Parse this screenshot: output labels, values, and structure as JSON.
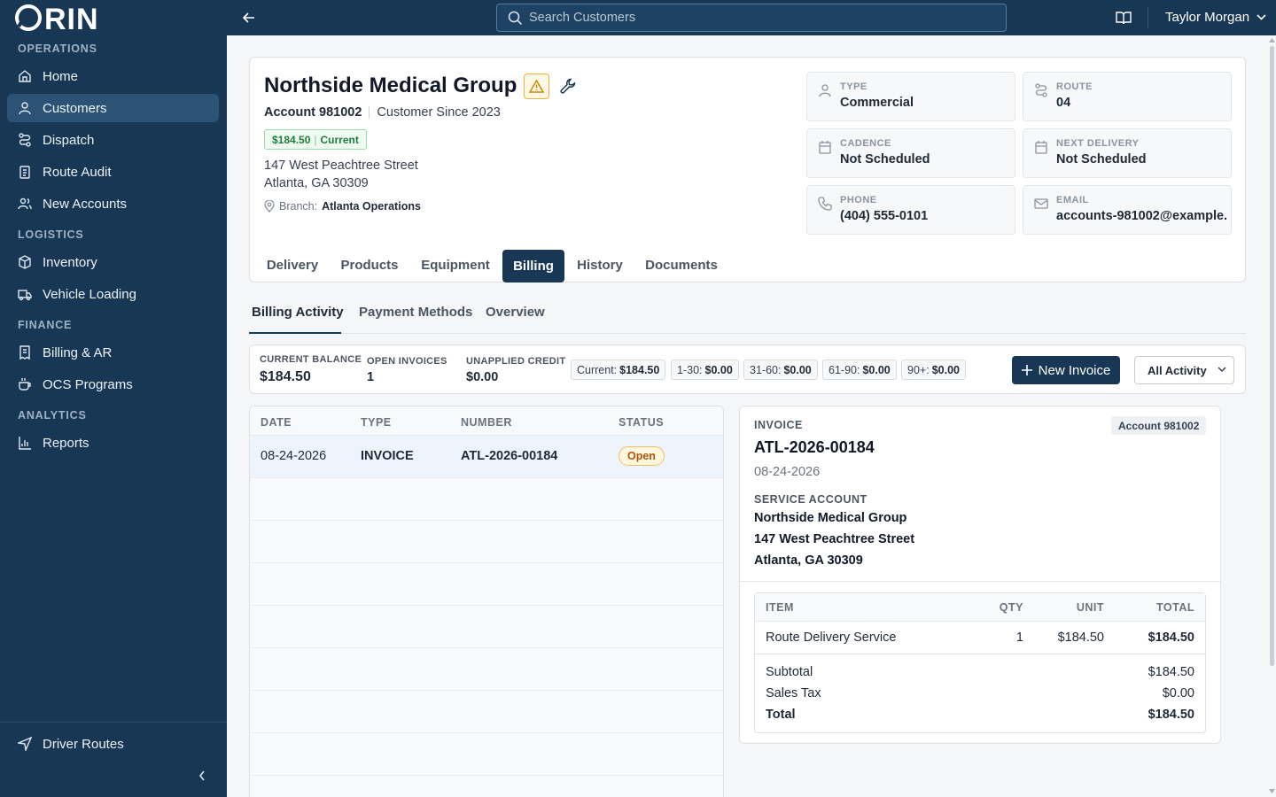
{
  "brand": {
    "logo_text": "ORIN"
  },
  "sidebar": {
    "sections": [
      {
        "title": "OPERATIONS"
      },
      {
        "title": "LOGISTICS"
      },
      {
        "title": "FINANCE"
      },
      {
        "title": "ANALYTICS"
      }
    ],
    "items": [
      {
        "label": "Home",
        "icon": "home-icon"
      },
      {
        "label": "Customers",
        "icon": "user-icon",
        "active": true
      },
      {
        "label": "Dispatch",
        "icon": "route-icon"
      },
      {
        "label": "Route Audit",
        "icon": "clipboard-icon"
      },
      {
        "label": "New Accounts",
        "icon": "users-icon"
      },
      {
        "label": "Inventory",
        "icon": "box-icon"
      },
      {
        "label": "Vehicle Loading",
        "icon": "truck-icon"
      },
      {
        "label": "Billing & AR",
        "icon": "receipt-icon"
      },
      {
        "label": "OCS Programs",
        "icon": "coffee-icon"
      },
      {
        "label": "Reports",
        "icon": "bar-chart-icon"
      }
    ],
    "footer_item": {
      "label": "Driver Routes",
      "icon": "navigation-icon"
    }
  },
  "topbar": {
    "search_placeholder": "Search Customers",
    "user_name": "Taylor Morgan"
  },
  "customer": {
    "name": "Northside Medical Group",
    "account": "Account 981002",
    "since": "Customer Since 2023",
    "balance": "$184.50",
    "balance_status": "Current",
    "address_line1": "147 West Peachtree Street",
    "address_line2": "Atlanta, GA 30309",
    "branch_label": "Branch:",
    "branch": "Atlanta Operations",
    "info": {
      "type_label": "TYPE",
      "type": "Commercial",
      "route_label": "ROUTE",
      "route": "04",
      "cadence_label": "CADENCE",
      "cadence": "Not Scheduled",
      "next_delivery_label": "NEXT DELIVERY",
      "next_delivery": "Not Scheduled",
      "phone_label": "PHONE",
      "phone": "(404) 555-0101",
      "email_label": "EMAIL",
      "email": "accounts-981002@example."
    }
  },
  "tabs": [
    {
      "label": "Delivery"
    },
    {
      "label": "Products"
    },
    {
      "label": "Equipment"
    },
    {
      "label": "Billing",
      "active": true
    },
    {
      "label": "History"
    },
    {
      "label": "Documents"
    }
  ],
  "subtabs": [
    {
      "label": "Billing Activity",
      "active": true
    },
    {
      "label": "Payment Methods"
    },
    {
      "label": "Overview"
    }
  ],
  "summary": {
    "current_balance_label": "CURRENT BALANCE",
    "current_balance": "$184.50",
    "open_invoices_label": "OPEN INVOICES",
    "open_invoices": "1",
    "unapplied_credit_label": "UNAPPLIED CREDIT",
    "unapplied_credit": "$0.00",
    "aging": [
      {
        "label": "Current:",
        "value": "$184.50"
      },
      {
        "label": "1-30:",
        "value": "$0.00"
      },
      {
        "label": "31-60:",
        "value": "$0.00"
      },
      {
        "label": "61-90:",
        "value": "$0.00"
      },
      {
        "label": "90+:",
        "value": "$0.00"
      }
    ],
    "new_invoice_label": "New Invoice",
    "filter_value": "All Activity"
  },
  "activity_table": {
    "columns": [
      "DATE",
      "TYPE",
      "NUMBER",
      "STATUS"
    ],
    "rows": [
      {
        "date": "08-24-2026",
        "type": "INVOICE",
        "number": "ATL-2026-00184",
        "status": "Open"
      }
    ]
  },
  "invoice": {
    "label": "INVOICE",
    "account_chip": "Account 981002",
    "number": "ATL-2026-00184",
    "date": "08-24-2026",
    "service_account_label": "SERVICE ACCOUNT",
    "service_name": "Northside Medical Group",
    "service_addr1": "147 West Peachtree Street",
    "service_addr2": "Atlanta, GA 30309",
    "columns": {
      "item": "ITEM",
      "qty": "QTY",
      "unit": "UNIT",
      "total": "TOTAL"
    },
    "lines": [
      {
        "item": "Route Delivery Service",
        "qty": "1",
        "unit": "$184.50",
        "total": "$184.50"
      }
    ],
    "subtotal_label": "Subtotal",
    "subtotal": "$184.50",
    "tax_label": "Sales Tax",
    "tax": "$0.00",
    "total_label": "Total",
    "total": "$184.50"
  },
  "colors": {
    "navy": "#173754",
    "active_nav": "#2c5275",
    "warning": "#e8b339",
    "success": "#1e7e3a"
  }
}
